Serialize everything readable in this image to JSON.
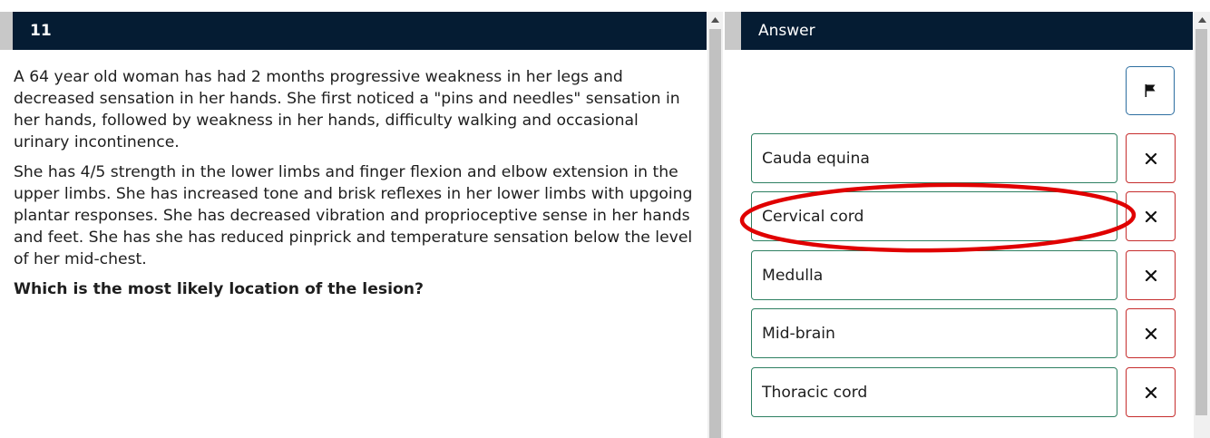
{
  "question": {
    "number": "11",
    "paragraphs": [
      "A 64 year old woman has had 2 months progressive weakness in her legs and decreased sensation in her hands. She first noticed a \"pins and needles\" sensation in her hands, followed by weakness in her hands, difficulty walking and occasional urinary incontinence.",
      "She has 4/5 strength in the lower limbs and finger flexion and elbow extension in the upper limbs. She has increased tone and brisk reflexes in her lower limbs with upgoing plantar responses. She has decreased vibration and proprioceptive sense in her hands and feet. She has she has reduced pinprick and temperature sensation below the level of her mid-chest."
    ],
    "prompt": "Which is the most likely location of the lesion?"
  },
  "answer_panel": {
    "title": "Answer",
    "flag_icon": "flag-icon",
    "strike_icon": "close-icon",
    "options": [
      {
        "label": "Cauda equina"
      },
      {
        "label": "Cervical cord",
        "highlighted": true
      },
      {
        "label": "Medulla"
      },
      {
        "label": "Mid-brain"
      },
      {
        "label": "Thoracic cord"
      }
    ]
  },
  "colors": {
    "header_bg": "#051c33",
    "option_border": "#2e8062",
    "strike_border": "#c62d2d",
    "flag_border": "#2d6ea0",
    "highlight": "#e00000"
  }
}
